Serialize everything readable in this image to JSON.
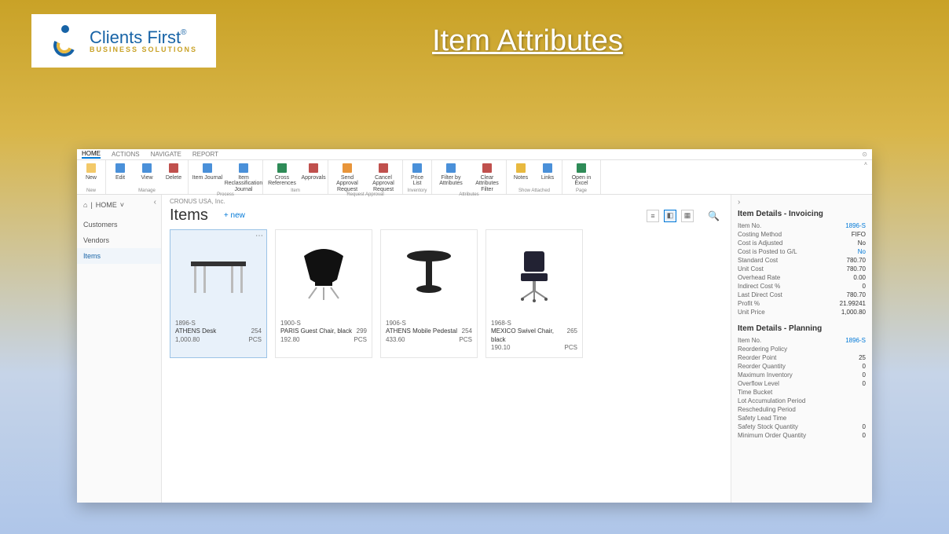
{
  "banner": {
    "logo_line1": "Clients First",
    "logo_line2": "BUSINESS SOLUTIONS",
    "title": "Item Attributes"
  },
  "ribbon_tabs": [
    "HOME",
    "ACTIONS",
    "NAVIGATE",
    "REPORT"
  ],
  "ribbon_active_tab": "HOME",
  "ribbon": {
    "groups": [
      {
        "label": "New",
        "buttons": [
          {
            "name": "new",
            "label": "New"
          }
        ]
      },
      {
        "label": "Manage",
        "buttons": [
          {
            "name": "edit",
            "label": "Edit"
          },
          {
            "name": "view",
            "label": "View"
          },
          {
            "name": "delete",
            "label": "Delete"
          }
        ]
      },
      {
        "label": "Process",
        "buttons": [
          {
            "name": "item-journal",
            "label": "Item Journal"
          },
          {
            "name": "item-reclass",
            "label": "Item Reclassification Journal"
          }
        ]
      },
      {
        "label": "Item",
        "buttons": [
          {
            "name": "cross-refs",
            "label": "Cross References"
          },
          {
            "name": "approvals",
            "label": "Approvals"
          }
        ]
      },
      {
        "label": "Request Approval",
        "buttons": [
          {
            "name": "send-approval",
            "label": "Send Approval Request"
          },
          {
            "name": "cancel-approval",
            "label": "Cancel Approval Request"
          }
        ]
      },
      {
        "label": "Inventory",
        "buttons": [
          {
            "name": "price-list",
            "label": "Price List"
          }
        ]
      },
      {
        "label": "Attributes",
        "buttons": [
          {
            "name": "filter-by-attr",
            "label": "Filter by Attributes"
          },
          {
            "name": "clear-attr-filter",
            "label": "Clear Attributes Filter"
          }
        ]
      },
      {
        "label": "Show Attached",
        "buttons": [
          {
            "name": "notes",
            "label": "Notes"
          },
          {
            "name": "links",
            "label": "Links"
          }
        ]
      },
      {
        "label": "Page",
        "buttons": [
          {
            "name": "open-excel",
            "label": "Open in Excel"
          }
        ]
      }
    ]
  },
  "sidebar": {
    "home_label": "HOME",
    "items": [
      {
        "label": "Customers"
      },
      {
        "label": "Vendors"
      },
      {
        "label": "Items"
      }
    ],
    "active_index": 2
  },
  "breadcrumb": "CRONUS USA, Inc.",
  "list": {
    "title": "Items",
    "new_link": "+ new"
  },
  "items": [
    {
      "sku": "1896-S",
      "name": "ATHENS Desk",
      "qty": "254",
      "uom": "PCS",
      "price": "1,000.80",
      "selected": true
    },
    {
      "sku": "1900-S",
      "name": "PARIS Guest Chair, black",
      "qty": "299",
      "uom": "PCS",
      "price": "192.80"
    },
    {
      "sku": "1906-S",
      "name": "ATHENS Mobile Pedestal",
      "qty": "254",
      "uom": "PCS",
      "price": "433.60"
    },
    {
      "sku": "1968-S",
      "name": "MEXICO Swivel Chair, black",
      "qty": "265",
      "uom": "PCS",
      "price": "190.10"
    }
  ],
  "details": {
    "invoicing": {
      "title": "Item Details - Invoicing",
      "rows": [
        {
          "k": "Item No.",
          "v": "1896-S",
          "link": true
        },
        {
          "k": "Costing Method",
          "v": "FIFO"
        },
        {
          "k": "Cost is Adjusted",
          "v": "No"
        },
        {
          "k": "Cost is Posted to G/L",
          "v": "No",
          "link": true
        },
        {
          "k": "Standard Cost",
          "v": "780.70"
        },
        {
          "k": "Unit Cost",
          "v": "780.70"
        },
        {
          "k": "Overhead Rate",
          "v": "0.00"
        },
        {
          "k": "Indirect Cost %",
          "v": "0"
        },
        {
          "k": "Last Direct Cost",
          "v": "780.70"
        },
        {
          "k": "Profit %",
          "v": "21.99241"
        },
        {
          "k": "Unit Price",
          "v": "1,000.80"
        }
      ]
    },
    "planning": {
      "title": "Item Details - Planning",
      "rows": [
        {
          "k": "Item No.",
          "v": "1896-S",
          "link": true
        },
        {
          "k": "Reordering Policy",
          "v": ""
        },
        {
          "k": "Reorder Point",
          "v": "25"
        },
        {
          "k": "Reorder Quantity",
          "v": "0"
        },
        {
          "k": "Maximum Inventory",
          "v": "0"
        },
        {
          "k": "Overflow Level",
          "v": "0"
        },
        {
          "k": "Time Bucket",
          "v": ""
        },
        {
          "k": "Lot Accumulation Period",
          "v": ""
        },
        {
          "k": "Rescheduling Period",
          "v": ""
        },
        {
          "k": "Safety Lead Time",
          "v": ""
        },
        {
          "k": "Safety Stock Quantity",
          "v": "0"
        },
        {
          "k": "Minimum Order Quantity",
          "v": "0"
        }
      ]
    }
  }
}
